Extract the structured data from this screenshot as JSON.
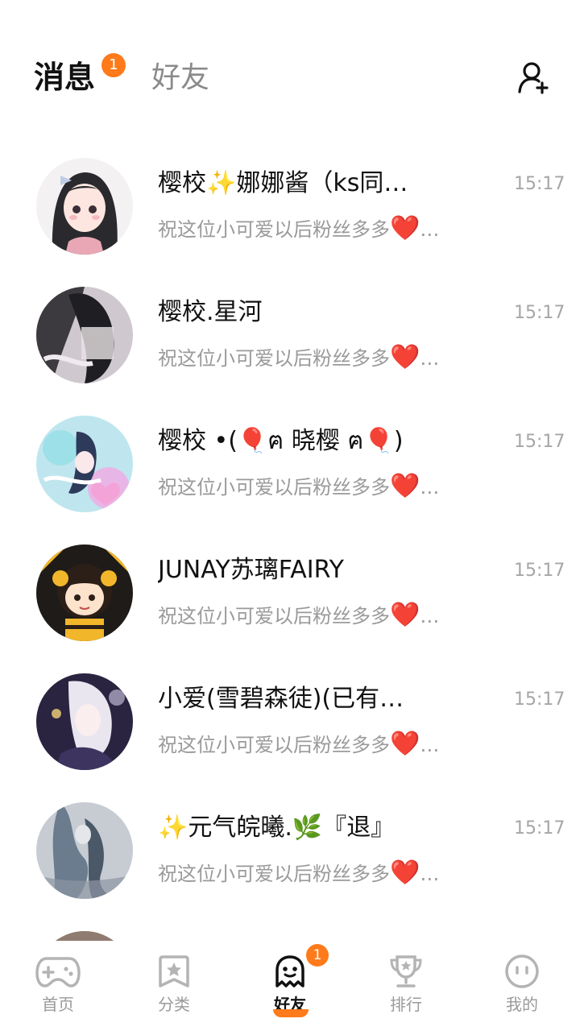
{
  "header": {
    "tab_messages": "消息",
    "tab_messages_badge": "1",
    "tab_friends": "好友",
    "add_friend_icon": "add-user-icon"
  },
  "conversations": [
    {
      "name": "樱校✨娜娜酱（ks同…",
      "time": "15:17",
      "preview_text": "祝这位小可爱以后粉丝多多",
      "preview_emoji": "❤️",
      "preview_ellipsis": "…"
    },
    {
      "name": "樱校.星河",
      "time": "15:17",
      "preview_text": "祝这位小可爱以后粉丝多多",
      "preview_emoji": "❤️",
      "preview_ellipsis": "…"
    },
    {
      "name": "樱校 •(🎈ฅ 晓樱 ฅ🎈)",
      "time": "15:17",
      "preview_text": "祝这位小可爱以后粉丝多多",
      "preview_emoji": "❤️",
      "preview_ellipsis": "…"
    },
    {
      "name": "JUNAY苏璃FAIRY",
      "time": "15:17",
      "preview_text": "祝这位小可爱以后粉丝多多",
      "preview_emoji": "❤️",
      "preview_ellipsis": "…"
    },
    {
      "name": "小爱(雪碧森徒)(已有…",
      "time": "15:17",
      "preview_text": "祝这位小可爱以后粉丝多多",
      "preview_emoji": "❤️",
      "preview_ellipsis": "…"
    },
    {
      "name": "✨元气皖曦.🌿『退』",
      "time": "15:17",
      "preview_text": "祝这位小可爱以后粉丝多多",
      "preview_emoji": "❤️",
      "preview_ellipsis": "…"
    }
  ],
  "bottom_nav": {
    "items": [
      {
        "label": "首页",
        "icon": "gamepad-icon"
      },
      {
        "label": "分类",
        "icon": "star-bookmark-icon"
      },
      {
        "label": "好友",
        "icon": "ghost-icon",
        "badge": "1",
        "active": true
      },
      {
        "label": "排行",
        "icon": "trophy-icon"
      },
      {
        "label": "我的",
        "icon": "face-icon"
      }
    ]
  },
  "colors": {
    "accent": "#ff7a1a",
    "heart": "#e8202a",
    "text_primary": "#111111",
    "text_secondary": "#9a9a9a"
  }
}
